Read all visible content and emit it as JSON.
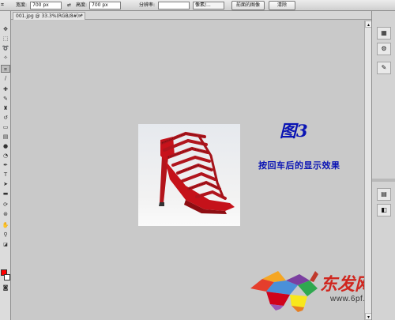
{
  "options_bar": {
    "width_label": "宽度:",
    "width_value": "700 px",
    "height_label": "高度:",
    "height_value": "700 px",
    "resolution_label": "分辨率:",
    "resolution_value": "",
    "unit_select": "像素/...",
    "front_image_button": "前面的图像",
    "clear_button": "清除"
  },
  "document": {
    "tab_title": "001.jpg @ 33.3%(RGB/8#) *",
    "tab_close": "×"
  },
  "canvas": {
    "figure_title": "图3",
    "figure_caption": "按回车后的显示效果"
  },
  "watermark": {
    "site_name": "东发网",
    "site_url": "www.6pf.cn"
  },
  "colors": {
    "foreground": "#ff0000",
    "background": "#ffffff",
    "caption": "#0a14b4"
  }
}
